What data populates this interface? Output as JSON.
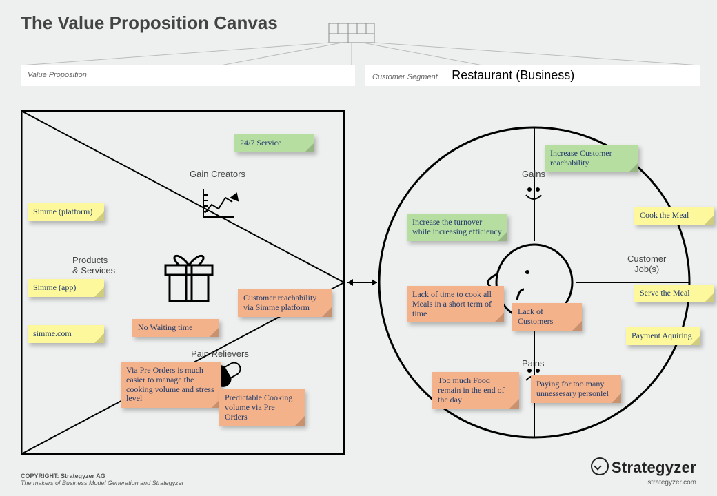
{
  "title": "The Value Proposition Canvas",
  "headers": {
    "left_label": "Value Proposition",
    "left_value": "",
    "right_label": "Customer Segment",
    "right_value": "Restaurant (Business)"
  },
  "sections": {
    "products_services": "Products\n& Services",
    "gain_creators": "Gain Creators",
    "pain_relievers": "Pain Relievers",
    "gains": "Gains",
    "pains": "Pains",
    "customer_jobs": "Customer\nJob(s)"
  },
  "notes": {
    "products": [
      {
        "text": "Simme (platform)",
        "color": "yellow"
      },
      {
        "text": "Simme (app)",
        "color": "yellow"
      },
      {
        "text": "simme.com",
        "color": "yellow"
      }
    ],
    "gain_creators": [
      {
        "text": "24/7 Service",
        "color": "green"
      }
    ],
    "pain_relievers": [
      {
        "text": "No Waiting time",
        "color": "orange"
      },
      {
        "text": "Via Pre Orders is much easier to manage the cooking volume and stress level",
        "color": "orange"
      },
      {
        "text": "Customer reachability via Simme platform",
        "color": "orange"
      },
      {
        "text": "Predictable Cooking volume via Pre Orders",
        "color": "orange"
      }
    ],
    "gains": [
      {
        "text": "Increase Customer reachability",
        "color": "green"
      },
      {
        "text": "Increase the turnover while increasing efficiency",
        "color": "green"
      }
    ],
    "pains": [
      {
        "text": "Lack of time to cook all Meals in a short term of time",
        "color": "orange"
      },
      {
        "text": "Lack of Customers",
        "color": "orange"
      },
      {
        "text": "Too much Food remain in the end of the day",
        "color": "orange"
      },
      {
        "text": "Paying for too many unnessesary personlel",
        "color": "orange"
      }
    ],
    "jobs": [
      {
        "text": "Cook the Meal",
        "color": "yellow"
      },
      {
        "text": "Serve the Meal",
        "color": "yellow"
      },
      {
        "text": "Payment Aquiring",
        "color": "yellow"
      }
    ]
  },
  "footer": {
    "copyright_line1": "COPYRIGHT: Strategyzer AG",
    "copyright_line2": "The makers of Business Model Generation and Strategyzer",
    "brand": "Strategyzer",
    "url": "strategyzer.com"
  }
}
